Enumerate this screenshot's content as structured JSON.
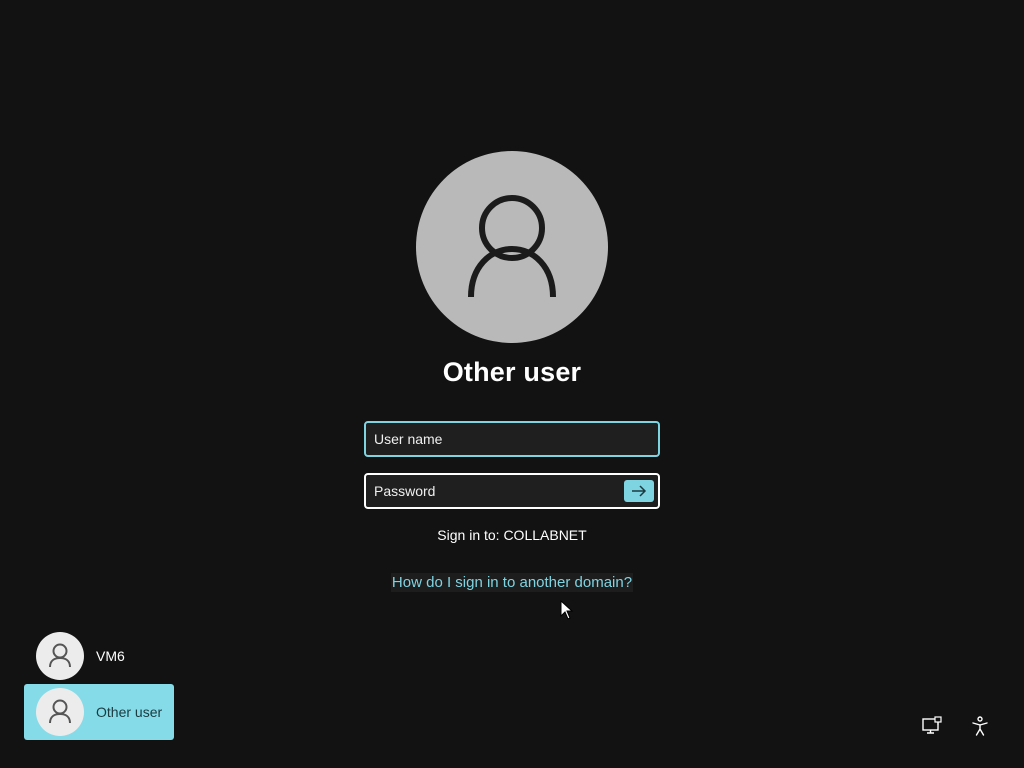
{
  "login": {
    "selected_user_name": "Other user",
    "username_placeholder": "User name",
    "password_placeholder": "Password",
    "sign_in_to": "Sign in to: COLLABNET",
    "domain_help_link": "How do I sign in to another domain?"
  },
  "user_list": [
    {
      "name": "VM6",
      "icon": "person-icon",
      "selected": false
    },
    {
      "name": "Other user",
      "icon": "person-icon",
      "selected": true
    }
  ],
  "system_tray": {
    "network_icon": "network-icon",
    "accessibility_icon": "accessibility-icon"
  },
  "colors": {
    "background": "#121212",
    "accent": "#7fd4e2",
    "selected_tile": "#86dbe8",
    "avatar_large": "#b9b9b9"
  }
}
